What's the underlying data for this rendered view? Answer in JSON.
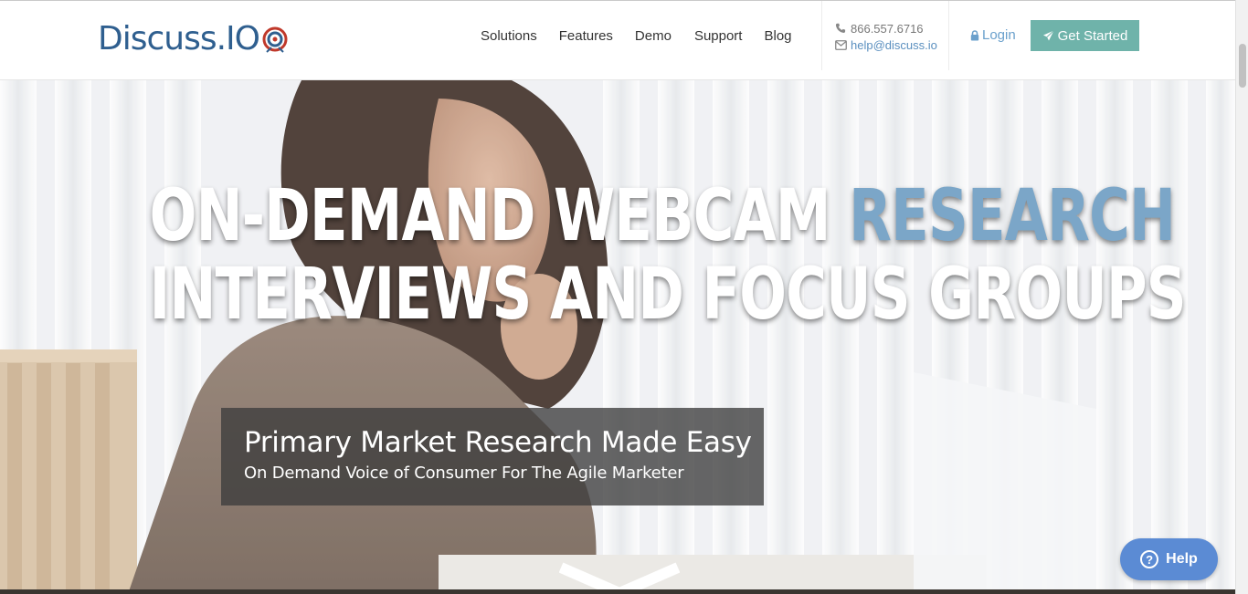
{
  "brand": {
    "logo_text": "Discuss.IO"
  },
  "nav": {
    "items": [
      {
        "label": "Solutions"
      },
      {
        "label": "Features"
      },
      {
        "label": "Demo"
      },
      {
        "label": "Support"
      },
      {
        "label": "Blog"
      }
    ]
  },
  "contact": {
    "phone": "866.557.6716",
    "email": "help@discuss.io",
    "phone_icon": "phone-icon",
    "email_icon": "envelope-icon"
  },
  "auth": {
    "login_label": "Login",
    "login_icon": "lock-icon",
    "cta_label": "Get Started",
    "cta_icon": "rocket-icon"
  },
  "hero": {
    "headline_part1": "ON-DEMAND WEBCAM ",
    "headline_accent": "RESEARCH",
    "headline_line2": "INTERVIEWS AND FOCUS GROUPS",
    "tagline_title": "Primary Market Research Made Easy",
    "tagline_sub": "On Demand Voice of Consumer For The Agile Marketer",
    "scroll_icon": "chevron-down-icon"
  },
  "help": {
    "label": "Help",
    "icon": "question-circle-icon"
  },
  "colors": {
    "brand_blue": "#2f5f8f",
    "accent_blue": "#7ba6c8",
    "link_blue": "#5a8fbf",
    "cta_teal": "#6fb3aa",
    "help_blue": "#5b8bd4",
    "target_red": "#c0392b"
  }
}
